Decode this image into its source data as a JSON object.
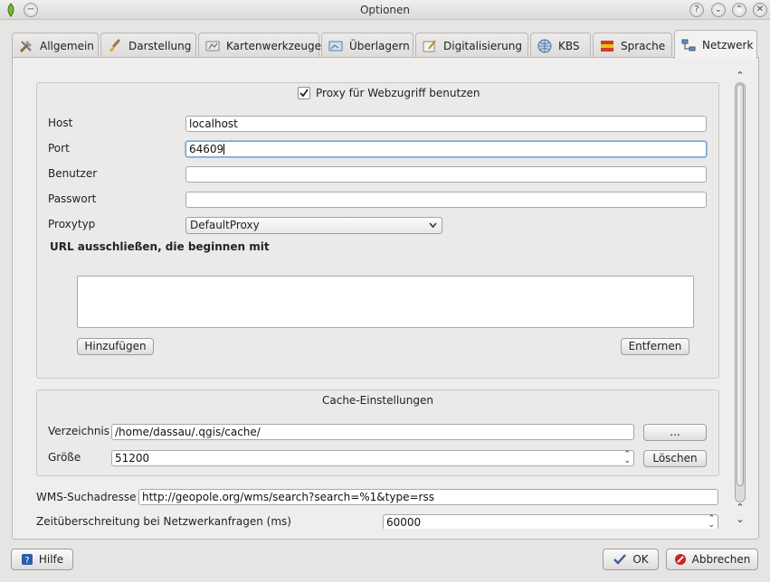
{
  "window": {
    "title": "Optionen"
  },
  "tabs": [
    {
      "label": "Allgemein",
      "icon": "tools-icon"
    },
    {
      "label": "Darstellung",
      "icon": "brush-icon"
    },
    {
      "label": "Kartenwerkzeuge",
      "icon": "map-tools-icon"
    },
    {
      "label": "Überlagern",
      "icon": "overlay-icon"
    },
    {
      "label": "Digitalisierung",
      "icon": "digitize-icon"
    },
    {
      "label": "KBS",
      "icon": "globe-icon"
    },
    {
      "label": "Sprache",
      "icon": "flag-icon"
    },
    {
      "label": "Netzwerk",
      "icon": "network-icon",
      "active": true
    }
  ],
  "proxy": {
    "enable_label": "Proxy für Webzugriff benutzen",
    "enabled": true,
    "host_label": "Host",
    "host_value": "localhost",
    "port_label": "Port",
    "port_value": "64609",
    "user_label": "Benutzer",
    "user_value": "",
    "password_label": "Passwort",
    "password_value": "",
    "type_label": "Proxytyp",
    "type_value": "DefaultProxy",
    "exclude_label": "URL ausschließen, die beginnen mit",
    "add_button": "Hinzufügen",
    "remove_button": "Entfernen"
  },
  "cache": {
    "title": "Cache-Einstellungen",
    "dir_label": "Verzeichnis",
    "dir_value": "/home/dassau/.qgis/cache/",
    "browse_button": "...",
    "size_label": "Größe",
    "size_value": "51200",
    "clear_button": "Löschen"
  },
  "wms": {
    "search_label": "WMS-Suchadresse",
    "search_value": "http://geopole.org/wms/search?search=%1&type=rss",
    "timeout_label": "Zeitüberschreitung bei Netzwerkanfragen (ms)",
    "timeout_value": "60000"
  },
  "footer": {
    "help_button": "Hilfe",
    "ok_button": "OK",
    "cancel_button": "Abbrechen"
  },
  "colors": {
    "window_bg": "#e6e5e4",
    "focus_border": "#6fa3d8",
    "cancel_icon": "#cc2222",
    "help_icon": "#2a5ca8"
  }
}
